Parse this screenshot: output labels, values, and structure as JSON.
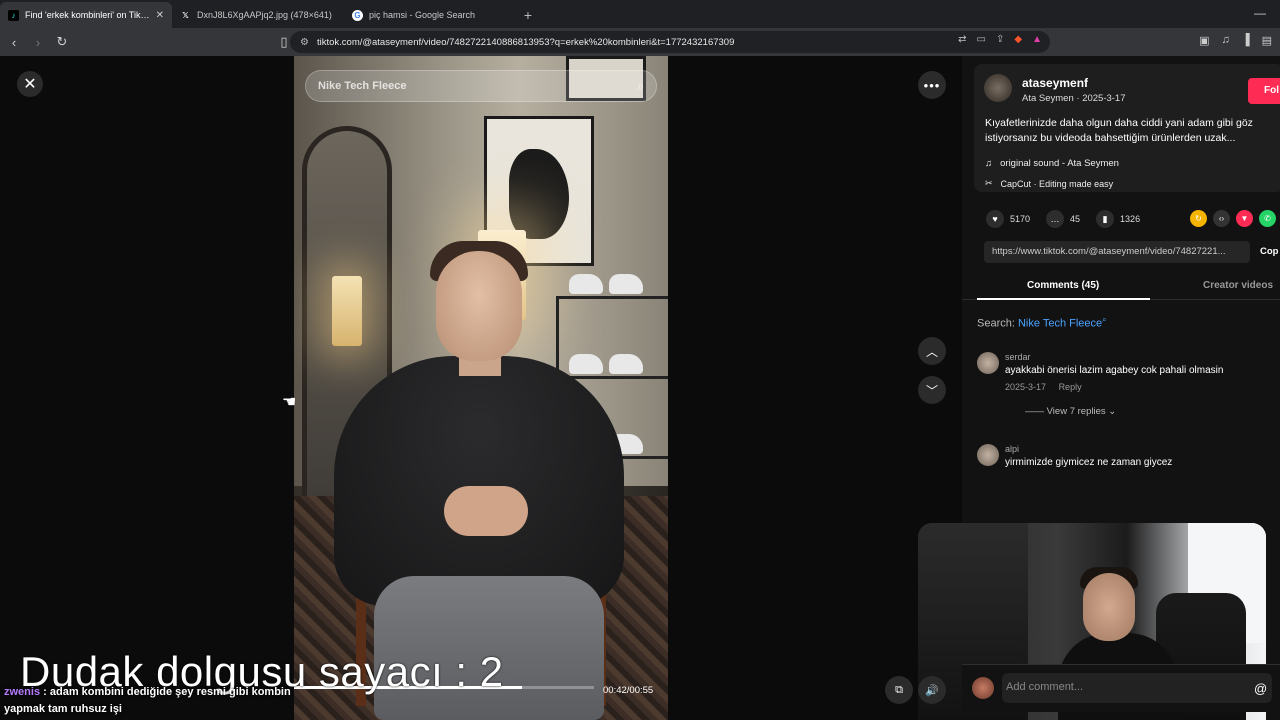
{
  "browser": {
    "tabs": [
      {
        "title": "Find 'erkek kombinleri' on TikTok",
        "active": true,
        "favicon": "tiktok-icon"
      },
      {
        "title": "DxnJ8L6XgAAPjq2.jpg (478×641)",
        "active": false,
        "favicon": "x-icon"
      },
      {
        "title": "piç hamsi - Google Search",
        "active": false,
        "favicon": "google-icon"
      }
    ],
    "url": "tiktok.com/@ataseymenf/video/7482722140886813953?q=erkek%20kombinleri&t=1772432167309"
  },
  "video": {
    "search_placeholder": "Nike Tech Fleece",
    "time": "00:42/00:55",
    "progress": 0.76
  },
  "post": {
    "username": "ataseymenf",
    "subline": "Ata Seymen · 2025-3-17",
    "follow_label": "Fol",
    "description": "Kıyafetlerinizde daha olgun daha ciddi yani adam gibi göz istiyorsanız bu videoda bahsettiğim ürünlerden uzak...",
    "sound": "original sound - Ata Seymen",
    "capcut": "CapCut · Editing made easy",
    "likes": "5170",
    "comments": "45",
    "saves": "1326",
    "link": "https://www.tiktok.com/@ataseymenf/video/74827221...",
    "copy_label": "Cop"
  },
  "panel": {
    "tab_comments": "Comments (45)",
    "tab_creator": "Creator videos",
    "search_prefix": "Search:",
    "search_term": "Nike Tech Fleece",
    "comments_list": [
      {
        "user": "serdar",
        "text": "ayakkabi önerisi lazim agabey cok pahali olmasin",
        "date": "2025-3-17",
        "reply": "Reply",
        "view_replies": "View 7 replies"
      },
      {
        "user": "alpi",
        "text": "yirmimizde giymicez ne zaman giycez"
      }
    ],
    "add_comment_placeholder": "Add comment..."
  },
  "overlay": {
    "counter": "Dudak dolgusu  sayacı : 2",
    "chat_user": "zwenis",
    "chat_text": ": adam kombini dediğide şey resmi gibi kombin yapmak tam ruhsuz işi"
  },
  "colors": {
    "follow": "#fe2c55",
    "search_term": "#4aa3ff",
    "chat_user": "#b57cff"
  }
}
